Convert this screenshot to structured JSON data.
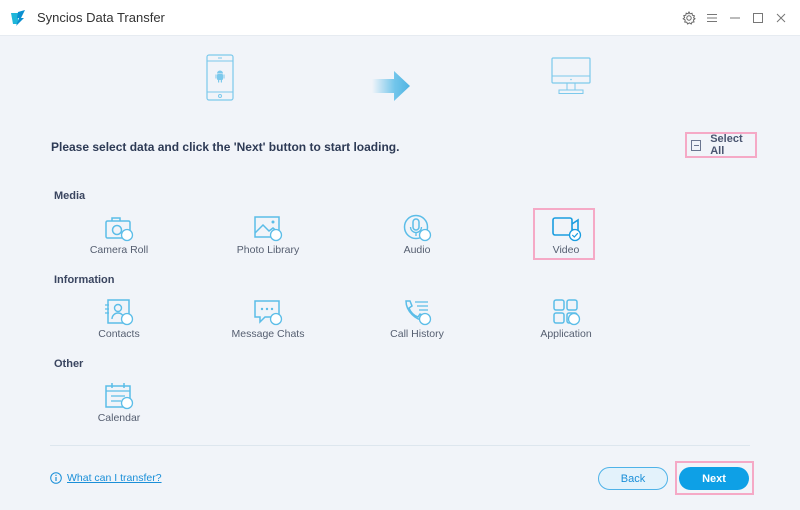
{
  "window": {
    "title": "Syncios Data Transfer",
    "controls": [
      "settings",
      "menu",
      "minimize",
      "maximize",
      "close"
    ]
  },
  "hero": {
    "source_device": "android-phone",
    "direction": "right-arrow",
    "target_device": "computer-monitor"
  },
  "instruction": "Please select data and click the 'Next' button to start loading.",
  "select_all": {
    "label": "Select All",
    "checked": false
  },
  "sections": [
    {
      "label": "Media",
      "items": [
        {
          "label": "Camera Roll",
          "icon": "camera-icon",
          "selected": false
        },
        {
          "label": "Photo Library",
          "icon": "photo-icon",
          "selected": false
        },
        {
          "label": "Audio",
          "icon": "microphone-icon",
          "selected": false
        },
        {
          "label": "Video",
          "icon": "video-icon",
          "selected": true
        }
      ]
    },
    {
      "label": "Information",
      "items": [
        {
          "label": "Contacts",
          "icon": "contacts-icon",
          "selected": false
        },
        {
          "label": "Message Chats",
          "icon": "chat-icon",
          "selected": false
        },
        {
          "label": "Call History",
          "icon": "phone-call-icon",
          "selected": false
        },
        {
          "label": "Application",
          "icon": "apps-grid-icon",
          "selected": false
        }
      ]
    },
    {
      "label": "Other",
      "items": [
        {
          "label": "Calendar",
          "icon": "calendar-icon",
          "selected": false
        }
      ]
    }
  ],
  "footer": {
    "help_link": "What can I transfer?",
    "back_label": "Back",
    "next_label": "Next"
  },
  "colors": {
    "accent": "#0ea0e6",
    "icon": "#5bbde8",
    "highlight": "#f5a9c6",
    "background": "#f1f4f9"
  }
}
